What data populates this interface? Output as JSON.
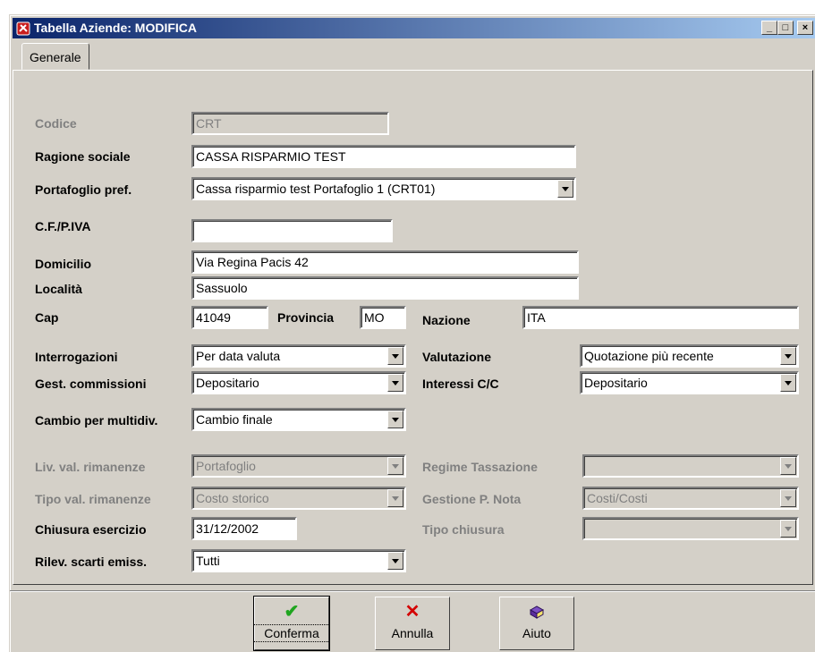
{
  "window": {
    "title": "Tabella Aziende: MODIFICA",
    "minimize": "_",
    "maximize": "□",
    "close": "×"
  },
  "tabs": [
    {
      "label": "Generale",
      "active": true
    }
  ],
  "form": {
    "codice": {
      "label": "Codice",
      "value": "CRT",
      "enabled": false
    },
    "ragione_sociale": {
      "label": "Ragione sociale",
      "value": "CASSA RISPARMIO TEST"
    },
    "portafoglio_pref": {
      "label": "Portafoglio pref.",
      "value": "Cassa risparmio test Portafoglio 1 (CRT01)"
    },
    "cf_piva": {
      "label": "C.F./P.IVA",
      "value": ""
    },
    "domicilio": {
      "label": "Domicilio",
      "value": "Via Regina Pacis 42"
    },
    "localita": {
      "label": "Località",
      "value": "Sassuolo"
    },
    "cap": {
      "label": "Cap",
      "value": "41049"
    },
    "provincia": {
      "label": "Provincia",
      "value": "MO"
    },
    "nazione": {
      "label": "Nazione",
      "value": "ITA"
    },
    "interrogazioni": {
      "label": "Interrogazioni",
      "value": "Per data valuta"
    },
    "valutazione": {
      "label": "Valutazione",
      "value": "Quotazione più recente"
    },
    "gest_commissioni": {
      "label": "Gest. commissioni",
      "value": "Depositario"
    },
    "interessi_cc": {
      "label": "Interessi C/C",
      "value": "Depositario"
    },
    "cambio_multidiv": {
      "label": "Cambio per multidiv.",
      "value": "Cambio finale"
    },
    "liv_val_rimanenze": {
      "label": "Liv. val. rimanenze",
      "value": "Portafoglio",
      "enabled": false
    },
    "regime_tassazione": {
      "label": "Regime Tassazione",
      "value": "",
      "enabled": false
    },
    "tipo_val_rimanenze": {
      "label": "Tipo val. rimanenze",
      "value": "Costo storico",
      "enabled": false
    },
    "gestione_p_nota": {
      "label": "Gestione P. Nota",
      "value": "Costi/Costi",
      "enabled": false
    },
    "chiusura_esercizio": {
      "label": "Chiusura esercizio",
      "value": "31/12/2002"
    },
    "tipo_chiusura": {
      "label": "Tipo chiusura",
      "value": "",
      "enabled": false
    },
    "rilev_scarti_emiss": {
      "label": "Rilev. scarti emiss.",
      "value": "Tutti"
    }
  },
  "buttons": {
    "conferma": {
      "label": "Conferma",
      "icon": "check-icon",
      "color": "#1fa51f"
    },
    "annulla": {
      "label": "Annulla",
      "icon": "x-icon",
      "color": "#d40000"
    },
    "aiuto": {
      "label": "Aiuto",
      "icon": "help-book-icon",
      "color": "#6a3aa0"
    }
  }
}
